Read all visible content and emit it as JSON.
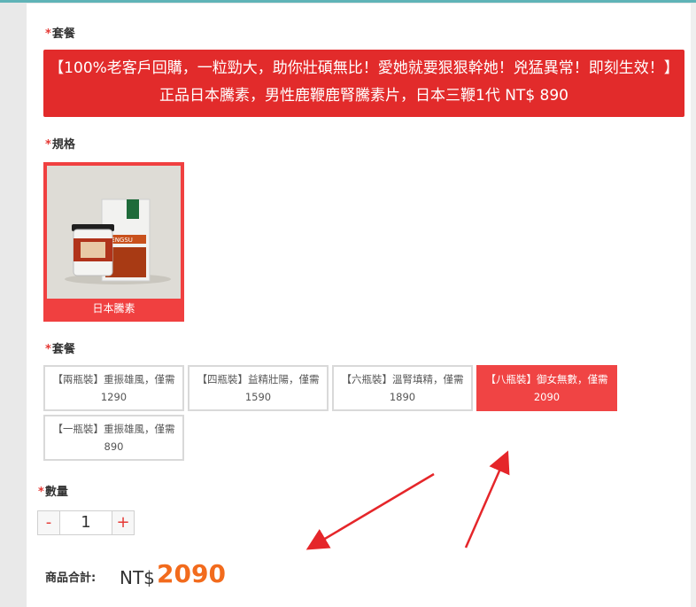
{
  "colors": {
    "accent_red": "#e22b2b",
    "selected_red": "#f04444",
    "price_orange": "#f26b1d"
  },
  "section1": {
    "star": "*",
    "label": "套餐",
    "promo_line1": "【100%老客戶回購，一粒勁大，助你壯碩無比！愛她就要狠狠幹她！兇猛異常！即刻生效！】",
    "promo_line2": "正品日本騰素，男性鹿鞭鹿腎騰素片，日本三鞭1代 NT$ 890"
  },
  "section2": {
    "star": "*",
    "label": "規格",
    "spec_caption": "日本騰素",
    "spec_box_text": "TENGSU"
  },
  "section3": {
    "star": "*",
    "label": "套餐",
    "options": [
      {
        "line1": "【兩瓶裝】重振雄風，僅需",
        "line2": "1290",
        "selected": false
      },
      {
        "line1": "【四瓶裝】益精壯陽，僅需",
        "line2": "1590",
        "selected": false
      },
      {
        "line1": "【六瓶裝】溫腎填精，僅需",
        "line2": "1890",
        "selected": false
      },
      {
        "line1": "【八瓶裝】御女無數，僅需",
        "line2": "2090",
        "selected": true
      },
      {
        "line1": "【一瓶裝】重振雄風，僅需",
        "line2": "890",
        "selected": false
      }
    ]
  },
  "quantity": {
    "star": "*",
    "label": "數量",
    "minus": "-",
    "value": "1",
    "plus": "+"
  },
  "total": {
    "label": "商品合計:",
    "currency": "NT$",
    "value": "2090"
  }
}
